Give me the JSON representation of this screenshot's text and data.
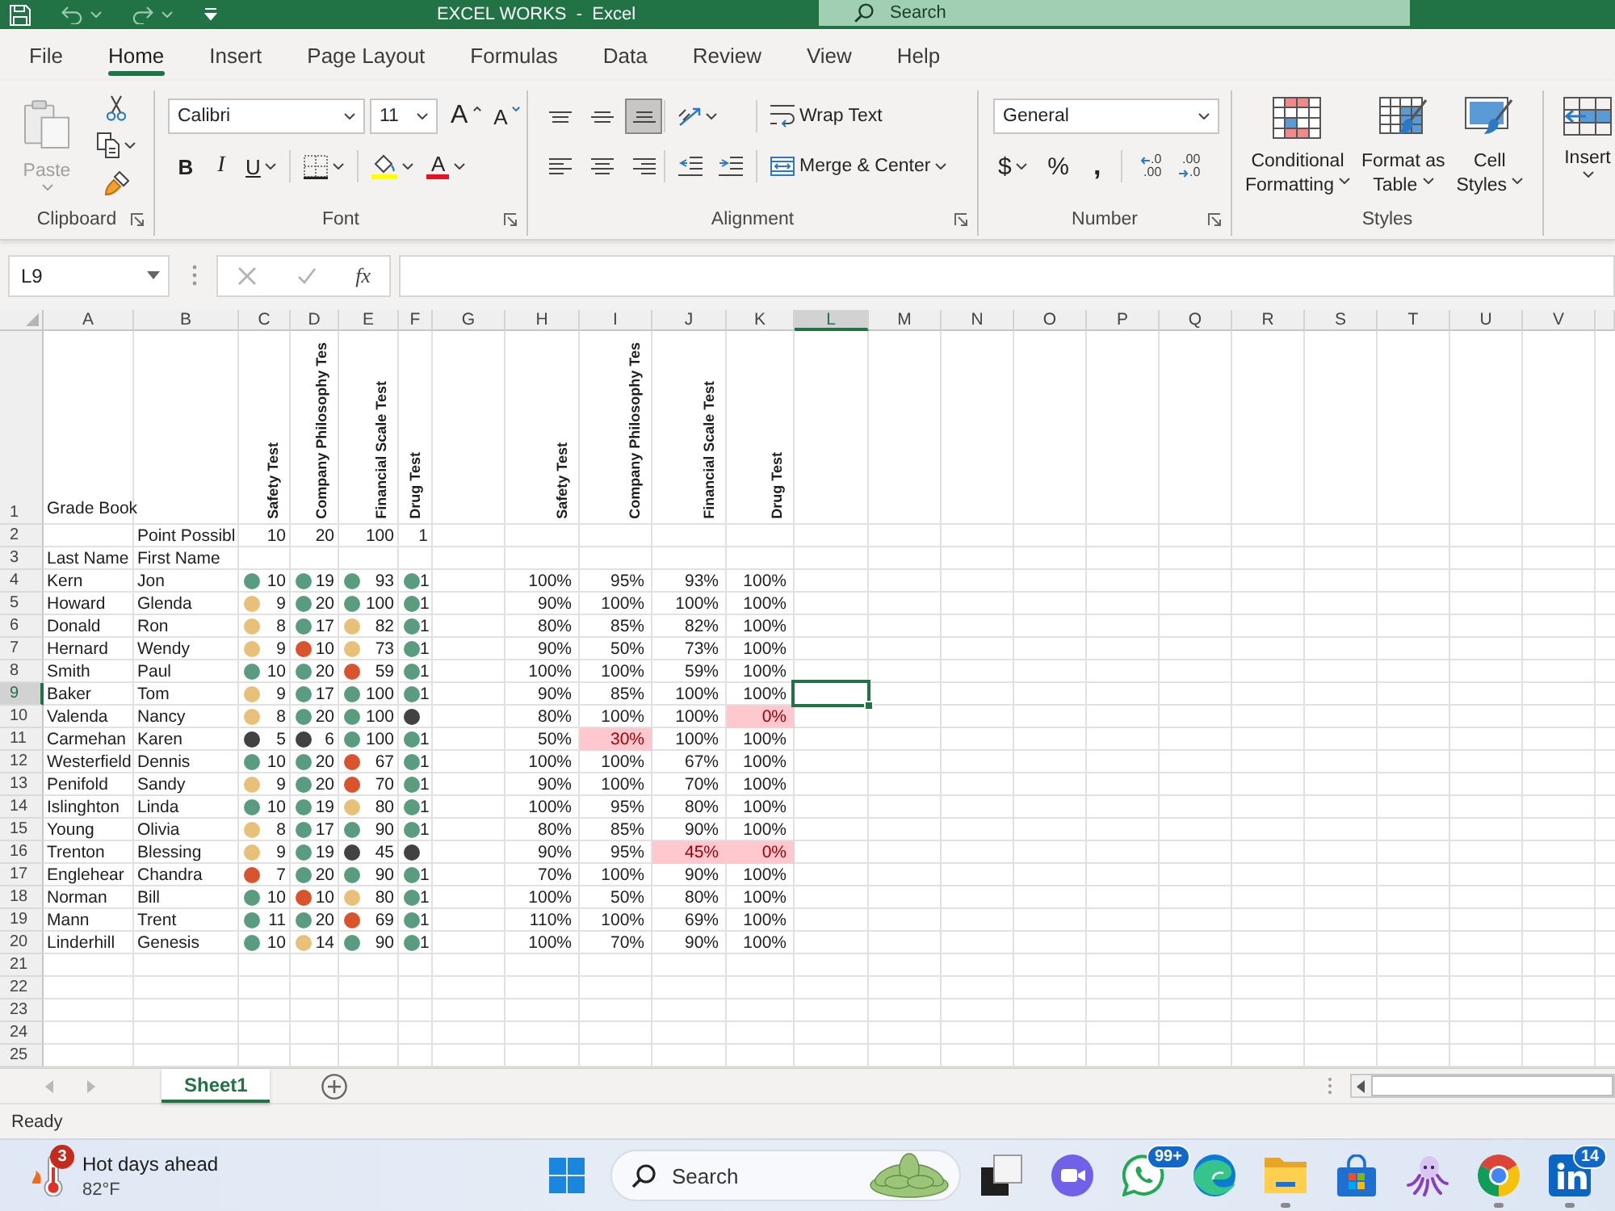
{
  "title_bar": {
    "title": "EXCEL WORKS  -  Excel",
    "search_placeholder": "Search"
  },
  "menu_tabs": [
    {
      "label": "File",
      "selected": false
    },
    {
      "label": "Home",
      "selected": true
    },
    {
      "label": "Insert",
      "selected": false
    },
    {
      "label": "Page Layout",
      "selected": false
    },
    {
      "label": "Formulas",
      "selected": false
    },
    {
      "label": "Data",
      "selected": false
    },
    {
      "label": "Review",
      "selected": false
    },
    {
      "label": "View",
      "selected": false
    },
    {
      "label": "Help",
      "selected": false
    }
  ],
  "ribbon": {
    "clipboard": {
      "label": "Clipboard",
      "paste": {
        "label": "Paste",
        "disabled": true
      }
    },
    "font": {
      "label": "Font",
      "family": "Calibri",
      "size": "11",
      "grow": "A",
      "shrink": "A",
      "styles": [
        {
          "kind": "bold",
          "label": "B"
        },
        {
          "kind": "italic",
          "label": "I"
        },
        {
          "kind": "underline",
          "label": "U"
        }
      ],
      "font_color": "A"
    },
    "alignment": {
      "label": "Alignment",
      "vertical": [
        {
          "kind": "top",
          "selected": false
        },
        {
          "kind": "middle",
          "selected": false
        },
        {
          "kind": "bottom",
          "selected": true
        }
      ],
      "horizontal": [
        {
          "kind": "left",
          "selected": false
        },
        {
          "kind": "center",
          "selected": false
        },
        {
          "kind": "right",
          "selected": false
        }
      ],
      "wrap_text": "Wrap Text",
      "merge": "Merge & Center"
    },
    "number": {
      "label": "Number",
      "format": "General",
      "currency": "$",
      "percent": "%",
      "comma": ",",
      "decimals": [
        {
          "kind": "increase",
          "top": ".0",
          "bottom": ".00"
        },
        {
          "kind": "decrease",
          "top": ".00",
          "bottom": ".0"
        }
      ]
    },
    "styles": {
      "label": "Styles",
      "buttons": [
        {
          "kind": "conditional",
          "lines": [
            "Conditional",
            "Formatting"
          ]
        },
        {
          "kind": "table",
          "lines": [
            "Format as",
            "Table"
          ]
        },
        {
          "kind": "cell",
          "lines": [
            "Cell",
            "Styles"
          ]
        }
      ]
    },
    "cells": {
      "insert": "Insert"
    }
  },
  "formula_bar": {
    "name_box": "L9",
    "edit_buttons": [
      {
        "kind": "cancel",
        "disabled": true
      },
      {
        "kind": "enter",
        "disabled": true
      }
    ],
    "function_label": "fx"
  },
  "sheet": {
    "columns": [
      {
        "label": "A",
        "selected": false
      },
      {
        "label": "B",
        "selected": false
      },
      {
        "label": "C",
        "selected": false
      },
      {
        "label": "D",
        "selected": false
      },
      {
        "label": "E",
        "selected": false
      },
      {
        "label": "F",
        "selected": false
      },
      {
        "label": "G",
        "selected": false
      },
      {
        "label": "H",
        "selected": false
      },
      {
        "label": "I",
        "selected": false
      },
      {
        "label": "J",
        "selected": false
      },
      {
        "label": "K",
        "selected": false
      },
      {
        "label": "L",
        "selected": true
      },
      {
        "label": "M",
        "selected": false
      },
      {
        "label": "N",
        "selected": false
      },
      {
        "label": "O",
        "selected": false
      },
      {
        "label": "P",
        "selected": false
      },
      {
        "label": "Q",
        "selected": false
      },
      {
        "label": "R",
        "selected": false
      },
      {
        "label": "S",
        "selected": false
      },
      {
        "label": "T",
        "selected": false
      },
      {
        "label": "U",
        "selected": false
      },
      {
        "label": "V",
        "selected": false
      }
    ],
    "header_row": {
      "number": "1",
      "selected": false,
      "title": "Grade Book",
      "score_headings": [
        "Safety Test",
        "Company Philosophy Tes",
        "Financial Scale Test",
        "Drug Test"
      ],
      "percent_headings": [
        "Safety Test",
        "Company Philosophy Tes",
        "Financial Scale Test",
        "Drug Test"
      ]
    },
    "points_row": {
      "number": "2",
      "selected": false,
      "label": "Point Possibl",
      "points": [
        "10",
        "20",
        "100",
        "1"
      ]
    },
    "label_row": {
      "number": "3",
      "selected": false,
      "last_name": "Last Name",
      "first_name": "First Name"
    },
    "students": [
      {
        "number": "4",
        "selected": false,
        "last_name": "Kern",
        "first_name": "Jon",
        "scores": [
          {
            "value": "10",
            "color": "#5a9c80"
          },
          {
            "value": "19",
            "color": "#5a9c80"
          },
          {
            "value": "93",
            "color": "#5a9c80"
          },
          {
            "value": "1",
            "color": "#5a9c80"
          }
        ],
        "percents": [
          {
            "value": "100%",
            "highlighted": false
          },
          {
            "value": "95%",
            "highlighted": false
          },
          {
            "value": "93%",
            "highlighted": false
          },
          {
            "value": "100%",
            "highlighted": false
          }
        ]
      },
      {
        "number": "5",
        "selected": false,
        "last_name": "Howard",
        "first_name": "Glenda",
        "scores": [
          {
            "value": "9",
            "color": "#e9c077"
          },
          {
            "value": "20",
            "color": "#5a9c80"
          },
          {
            "value": "100",
            "color": "#5a9c80"
          },
          {
            "value": "1",
            "color": "#5a9c80"
          }
        ],
        "percents": [
          {
            "value": "90%",
            "highlighted": false
          },
          {
            "value": "100%",
            "highlighted": false
          },
          {
            "value": "100%",
            "highlighted": false
          },
          {
            "value": "100%",
            "highlighted": false
          }
        ]
      },
      {
        "number": "6",
        "selected": false,
        "last_name": "Donald",
        "first_name": "Ron",
        "scores": [
          {
            "value": "8",
            "color": "#e9c077"
          },
          {
            "value": "17",
            "color": "#5a9c80"
          },
          {
            "value": "82",
            "color": "#e9c077"
          },
          {
            "value": "1",
            "color": "#5a9c80"
          }
        ],
        "percents": [
          {
            "value": "80%",
            "highlighted": false
          },
          {
            "value": "85%",
            "highlighted": false
          },
          {
            "value": "82%",
            "highlighted": false
          },
          {
            "value": "100%",
            "highlighted": false
          }
        ]
      },
      {
        "number": "7",
        "selected": false,
        "last_name": "Hernard",
        "first_name": "Wendy",
        "scores": [
          {
            "value": "9",
            "color": "#e9c077"
          },
          {
            "value": "10",
            "color": "#d9532c"
          },
          {
            "value": "73",
            "color": "#e9c077"
          },
          {
            "value": "1",
            "color": "#5a9c80"
          }
        ],
        "percents": [
          {
            "value": "90%",
            "highlighted": false
          },
          {
            "value": "50%",
            "highlighted": false
          },
          {
            "value": "73%",
            "highlighted": false
          },
          {
            "value": "100%",
            "highlighted": false
          }
        ]
      },
      {
        "number": "8",
        "selected": false,
        "last_name": "Smith",
        "first_name": "Paul",
        "scores": [
          {
            "value": "10",
            "color": "#5a9c80"
          },
          {
            "value": "20",
            "color": "#5a9c80"
          },
          {
            "value": "59",
            "color": "#d9532c"
          },
          {
            "value": "1",
            "color": "#5a9c80"
          }
        ],
        "percents": [
          {
            "value": "100%",
            "highlighted": false
          },
          {
            "value": "100%",
            "highlighted": false
          },
          {
            "value": "59%",
            "highlighted": false
          },
          {
            "value": "100%",
            "highlighted": false
          }
        ]
      },
      {
        "number": "9",
        "selected": true,
        "last_name": "Baker",
        "first_name": "Tom",
        "scores": [
          {
            "value": "9",
            "color": "#e9c077"
          },
          {
            "value": "17",
            "color": "#5a9c80"
          },
          {
            "value": "100",
            "color": "#5a9c80"
          },
          {
            "value": "1",
            "color": "#5a9c80"
          }
        ],
        "percents": [
          {
            "value": "90%",
            "highlighted": false
          },
          {
            "value": "85%",
            "highlighted": false
          },
          {
            "value": "100%",
            "highlighted": false
          },
          {
            "value": "100%",
            "highlighted": false
          }
        ]
      },
      {
        "number": "10",
        "selected": false,
        "last_name": "Valenda",
        "first_name": "Nancy",
        "scores": [
          {
            "value": "8",
            "color": "#e9c077"
          },
          {
            "value": "20",
            "color": "#5a9c80"
          },
          {
            "value": "100",
            "color": "#5a9c80"
          },
          {
            "color": "#424242"
          }
        ],
        "percents": [
          {
            "value": "80%",
            "highlighted": false
          },
          {
            "value": "100%",
            "highlighted": false
          },
          {
            "value": "100%",
            "highlighted": false
          },
          {
            "value": "0%",
            "highlighted": true
          }
        ]
      },
      {
        "number": "11",
        "selected": false,
        "last_name": "Carmehan",
        "first_name": "Karen",
        "scores": [
          {
            "value": "5",
            "color": "#424242"
          },
          {
            "value": "6",
            "color": "#424242"
          },
          {
            "value": "100",
            "color": "#5a9c80"
          },
          {
            "value": "1",
            "color": "#5a9c80"
          }
        ],
        "percents": [
          {
            "value": "50%",
            "highlighted": false
          },
          {
            "value": "30%",
            "highlighted": true
          },
          {
            "value": "100%",
            "highlighted": false
          },
          {
            "value": "100%",
            "highlighted": false
          }
        ]
      },
      {
        "number": "12",
        "selected": false,
        "last_name": "Westerfield",
        "first_name": "Dennis",
        "scores": [
          {
            "value": "10",
            "color": "#5a9c80"
          },
          {
            "value": "20",
            "color": "#5a9c80"
          },
          {
            "value": "67",
            "color": "#d9532c"
          },
          {
            "value": "1",
            "color": "#5a9c80"
          }
        ],
        "percents": [
          {
            "value": "100%",
            "highlighted": false
          },
          {
            "value": "100%",
            "highlighted": false
          },
          {
            "value": "67%",
            "highlighted": false
          },
          {
            "value": "100%",
            "highlighted": false
          }
        ]
      },
      {
        "number": "13",
        "selected": false,
        "last_name": "Penifold",
        "first_name": "Sandy",
        "scores": [
          {
            "value": "9",
            "color": "#e9c077"
          },
          {
            "value": "20",
            "color": "#5a9c80"
          },
          {
            "value": "70",
            "color": "#d9532c"
          },
          {
            "value": "1",
            "color": "#5a9c80"
          }
        ],
        "percents": [
          {
            "value": "90%",
            "highlighted": false
          },
          {
            "value": "100%",
            "highlighted": false
          },
          {
            "value": "70%",
            "highlighted": false
          },
          {
            "value": "100%",
            "highlighted": false
          }
        ]
      },
      {
        "number": "14",
        "selected": false,
        "last_name": "Islinghton",
        "first_name": "Linda",
        "scores": [
          {
            "value": "10",
            "color": "#5a9c80"
          },
          {
            "value": "19",
            "color": "#5a9c80"
          },
          {
            "value": "80",
            "color": "#e9c077"
          },
          {
            "value": "1",
            "color": "#5a9c80"
          }
        ],
        "percents": [
          {
            "value": "100%",
            "highlighted": false
          },
          {
            "value": "95%",
            "highlighted": false
          },
          {
            "value": "80%",
            "highlighted": false
          },
          {
            "value": "100%",
            "highlighted": false
          }
        ]
      },
      {
        "number": "15",
        "selected": false,
        "last_name": "Young",
        "first_name": "Olivia",
        "scores": [
          {
            "value": "8",
            "color": "#e9c077"
          },
          {
            "value": "17",
            "color": "#5a9c80"
          },
          {
            "value": "90",
            "color": "#5a9c80"
          },
          {
            "value": "1",
            "color": "#5a9c80"
          }
        ],
        "percents": [
          {
            "value": "80%",
            "highlighted": false
          },
          {
            "value": "85%",
            "highlighted": false
          },
          {
            "value": "90%",
            "highlighted": false
          },
          {
            "value": "100%",
            "highlighted": false
          }
        ]
      },
      {
        "number": "16",
        "selected": false,
        "last_name": "Trenton",
        "first_name": "Blessing",
        "scores": [
          {
            "value": "9",
            "color": "#e9c077"
          },
          {
            "value": "19",
            "color": "#5a9c80"
          },
          {
            "value": "45",
            "color": "#424242"
          },
          {
            "color": "#424242"
          }
        ],
        "percents": [
          {
            "value": "90%",
            "highlighted": false
          },
          {
            "value": "95%",
            "highlighted": false
          },
          {
            "value": "45%",
            "highlighted": true
          },
          {
            "value": "0%",
            "highlighted": true
          }
        ]
      },
      {
        "number": "17",
        "selected": false,
        "last_name": "Englehear",
        "first_name": "Chandra",
        "scores": [
          {
            "value": "7",
            "color": "#d9532c"
          },
          {
            "value": "20",
            "color": "#5a9c80"
          },
          {
            "value": "90",
            "color": "#5a9c80"
          },
          {
            "value": "1",
            "color": "#5a9c80"
          }
        ],
        "percents": [
          {
            "value": "70%",
            "highlighted": false
          },
          {
            "value": "100%",
            "highlighted": false
          },
          {
            "value": "90%",
            "highlighted": false
          },
          {
            "value": "100%",
            "highlighted": false
          }
        ]
      },
      {
        "number": "18",
        "selected": false,
        "last_name": "Norman",
        "first_name": "Bill",
        "scores": [
          {
            "value": "10",
            "color": "#5a9c80"
          },
          {
            "value": "10",
            "color": "#d9532c"
          },
          {
            "value": "80",
            "color": "#e9c077"
          },
          {
            "value": "1",
            "color": "#5a9c80"
          }
        ],
        "percents": [
          {
            "value": "100%",
            "highlighted": false
          },
          {
            "value": "50%",
            "highlighted": false
          },
          {
            "value": "80%",
            "highlighted": false
          },
          {
            "value": "100%",
            "highlighted": false
          }
        ]
      },
      {
        "number": "19",
        "selected": false,
        "last_name": "Mann",
        "first_name": "Trent",
        "scores": [
          {
            "value": "11",
            "color": "#5a9c80"
          },
          {
            "value": "20",
            "color": "#5a9c80"
          },
          {
            "value": "69",
            "color": "#d9532c"
          },
          {
            "value": "1",
            "color": "#5a9c80"
          }
        ],
        "percents": [
          {
            "value": "110%",
            "highlighted": false
          },
          {
            "value": "100%",
            "highlighted": false
          },
          {
            "value": "69%",
            "highlighted": false
          },
          {
            "value": "100%",
            "highlighted": false
          }
        ]
      },
      {
        "number": "20",
        "selected": false,
        "last_name": "Linderhill",
        "first_name": "Genesis",
        "scores": [
          {
            "value": "10",
            "color": "#5a9c80"
          },
          {
            "value": "14",
            "color": "#e9c077"
          },
          {
            "value": "90",
            "color": "#5a9c80"
          },
          {
            "value": "1",
            "color": "#5a9c80"
          }
        ],
        "percents": [
          {
            "value": "100%",
            "highlighted": false
          },
          {
            "value": "70%",
            "highlighted": false
          },
          {
            "value": "90%",
            "highlighted": false
          },
          {
            "value": "100%",
            "highlighted": false
          }
        ]
      }
    ],
    "empty_rows": [
      {
        "number": "21",
        "selected": false
      },
      {
        "number": "22",
        "selected": false
      },
      {
        "number": "23",
        "selected": false
      },
      {
        "number": "24",
        "selected": false
      },
      {
        "number": "25",
        "selected": false
      }
    ]
  },
  "sheet_tabs": [
    {
      "label": "Sheet1",
      "selected": true
    }
  ],
  "status_bar": {
    "text": "Ready"
  },
  "taskbar": {
    "weather": {
      "badge": "3",
      "headline": "Hot days ahead",
      "temperature": "82°F"
    },
    "search_placeholder": "Search",
    "apps": [
      {
        "kind": "task-view",
        "running": false
      },
      {
        "kind": "meet",
        "running": false
      },
      {
        "kind": "chat",
        "badge": "99+",
        "running": false
      },
      {
        "kind": "edge",
        "running": false
      },
      {
        "kind": "folder",
        "running": true
      },
      {
        "kind": "store",
        "running": false
      },
      {
        "kind": "creature",
        "running": false
      },
      {
        "kind": "chrome",
        "running": true
      },
      {
        "kind": "linkedin",
        "badge": "14",
        "running": true
      }
    ]
  }
}
